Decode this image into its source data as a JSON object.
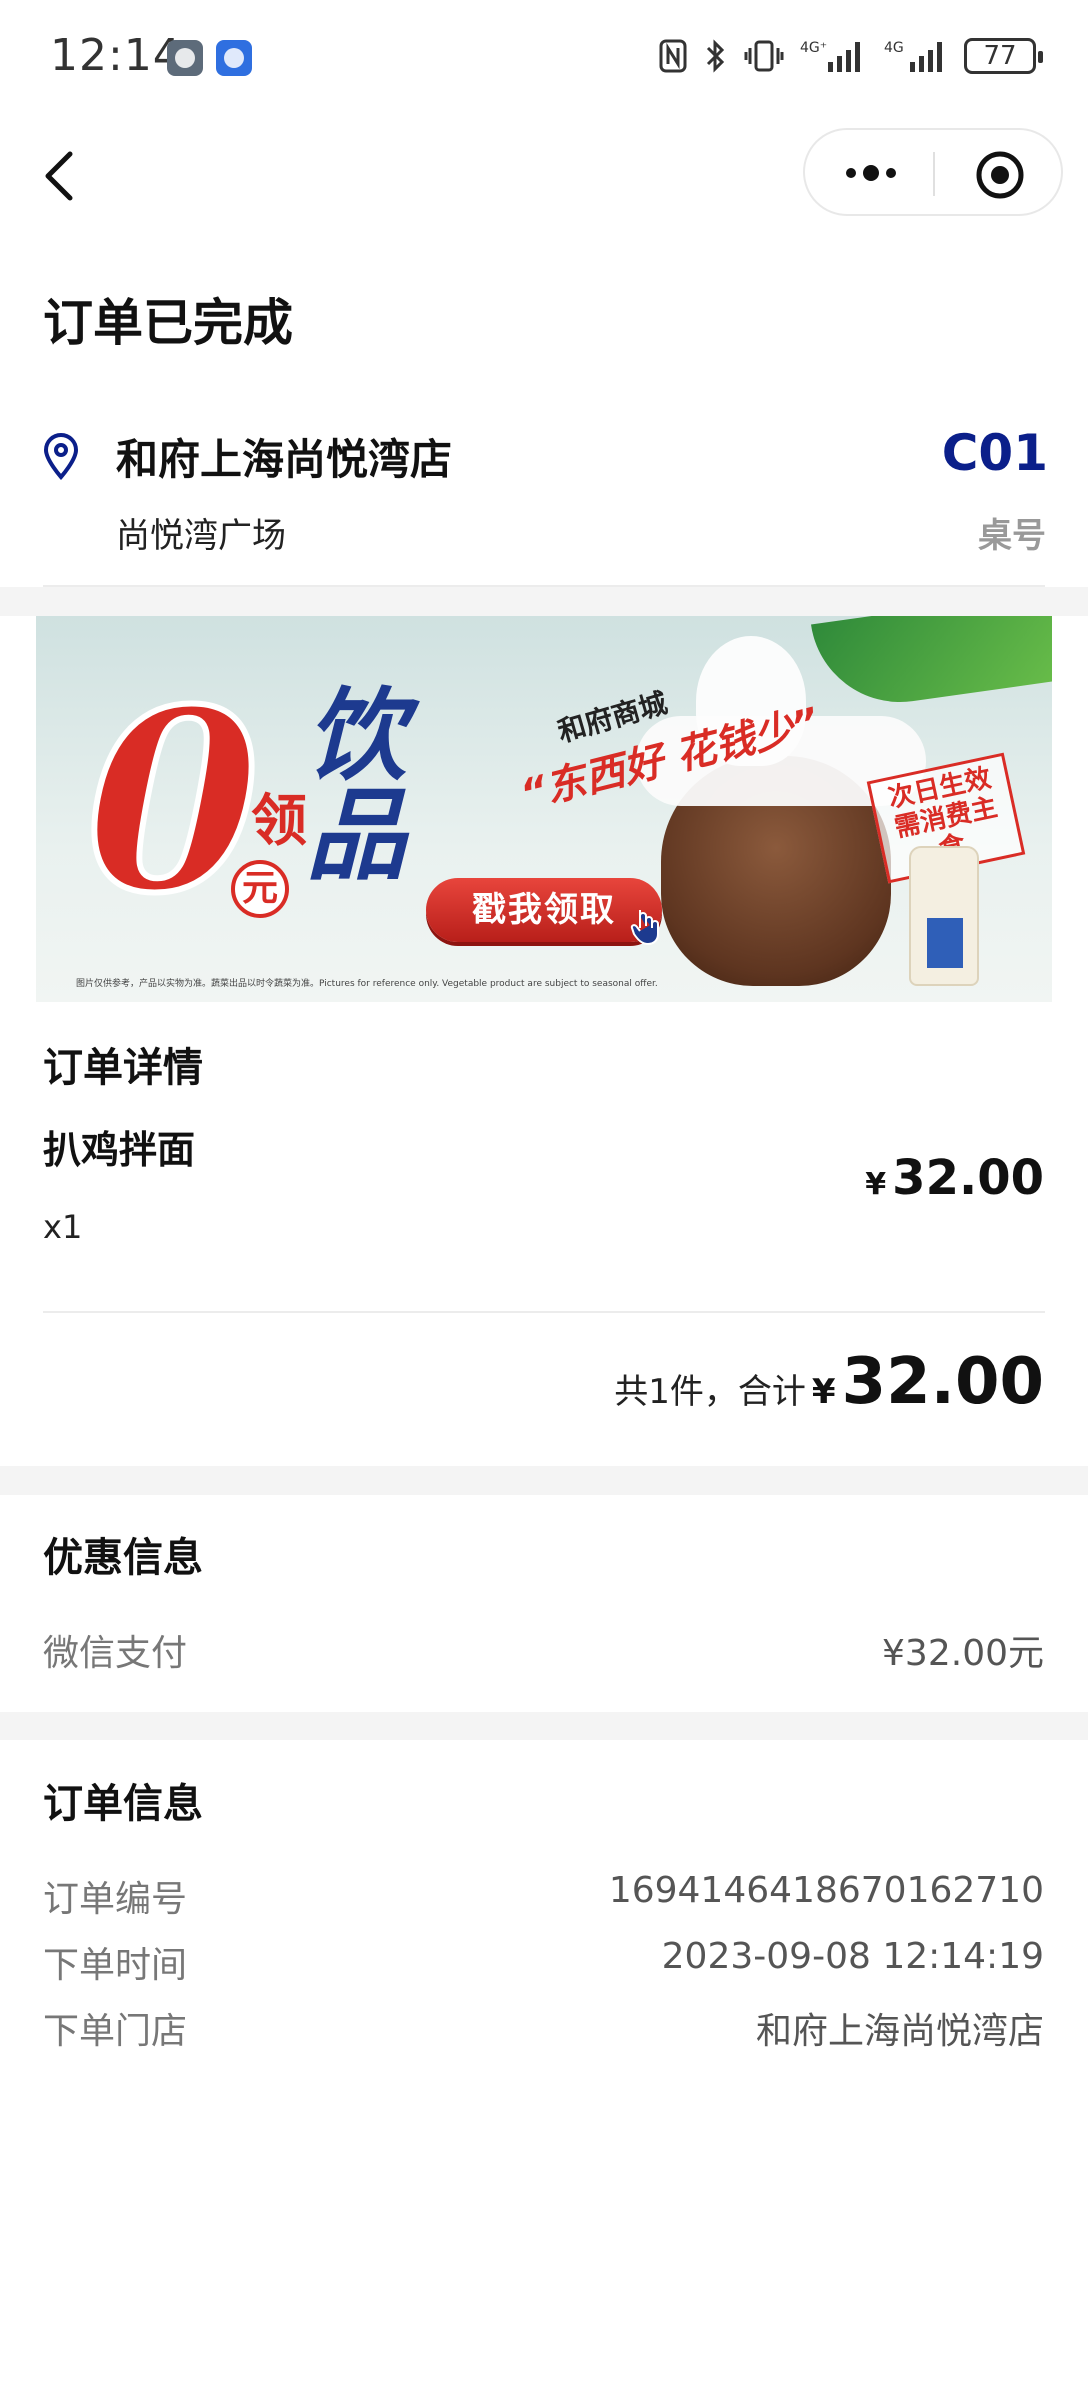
{
  "status_bar": {
    "time": "12:14",
    "battery": "77",
    "network1": "4G⁺",
    "network2": "4G",
    "icons": [
      "message-icon",
      "app-icon",
      "nfc-icon",
      "bluetooth-icon",
      "vibrate-icon",
      "signal-icon",
      "battery-icon"
    ]
  },
  "nav": {
    "back_icon": "chevron-left-icon",
    "more_icon": "more-dots-icon",
    "close_icon": "target-circle-icon"
  },
  "page_title": "订单已完成",
  "store": {
    "name": "和府上海尚悦湾店",
    "address": "尚悦湾广场",
    "table_no": "C01",
    "table_label": "桌号",
    "icon": "location-pin-icon",
    "accent_color": "#0b1f8a"
  },
  "banner": {
    "zero": "0",
    "ling": "领",
    "yuan": "元",
    "drink": "饮品",
    "brand": "和府商城",
    "slogan": "“东西好 花钱少”",
    "button": "戳我领取",
    "stamp_line1": "次日生效",
    "stamp_line2": "需消费主食",
    "footnote": "图片仅供参考，产品以实物为准。蔬菜出品以时令蔬菜为准。Pictures for reference only. Vegetable product are subject to seasonal offer."
  },
  "order_detail": {
    "title": "订单详情",
    "item_name": "扒鸡拌面",
    "item_qty": "x1",
    "item_yen": "¥",
    "item_price": "32.00",
    "total_text": "共1件，合计",
    "total_yen": "¥",
    "total_amount": "32.00"
  },
  "discount": {
    "title": "优惠信息",
    "pay_label": "微信支付",
    "pay_value": "¥32.00元"
  },
  "order_info": {
    "title": "订单信息",
    "rows": [
      {
        "label": "订单编号",
        "value": "1694146418670162710"
      },
      {
        "label": "下单时间",
        "value": "2023-09-08 12:14:19"
      },
      {
        "label": "下单门店",
        "value": "和府上海尚悦湾店"
      }
    ]
  }
}
